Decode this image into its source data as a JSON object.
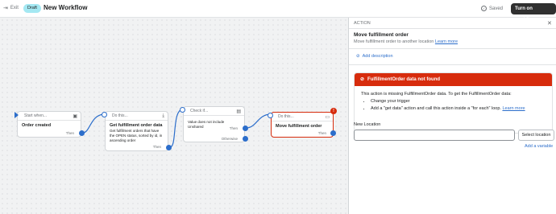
{
  "topbar": {
    "exit_label": "Exit",
    "status_badge": "Draft",
    "title": "New Workflow",
    "saved_label": "Saved",
    "turn_on_label": "Turn on workflow"
  },
  "nodes": {
    "start": {
      "header": "Start when...",
      "title": "Order created",
      "foot": "Then"
    },
    "get": {
      "header": "Do this...",
      "title": "Get fulfillment order data",
      "desc": "Get fulfillment orders that have the OPEN status, sorted by id, in ascending order",
      "foot": "Then"
    },
    "check": {
      "header": "Check if...",
      "desc": "Value does not include Unshared",
      "then": "Then",
      "otherwise": "Otherwise"
    },
    "move": {
      "header": "Do this...",
      "title": "Move fulfillment order",
      "foot": "Then",
      "error_mark": "!"
    }
  },
  "panel": {
    "section": "ACTION",
    "title": "Move fulfillment order",
    "subtitle": "Move fulfillment order to another location",
    "learn_more": "Learn more",
    "add_description": "Add description",
    "error": {
      "title": "FulfillmentOrder data not found",
      "message": "This action is missing FulfillmentOrder data. To get the FulfillmentOrder data:",
      "bullet1": "Change your trigger",
      "bullet2": "Add a \"get data\" action and call this action inside a \"for each\" loop.",
      "learn_more": "Learn more"
    },
    "field_label": "New Location",
    "field_value": "",
    "select_button": "Select location",
    "add_variable": "Add a variable"
  },
  "colors": {
    "accent": "#2c6ecb",
    "error": "#d72c0d",
    "badge": "#a4e8f2"
  }
}
